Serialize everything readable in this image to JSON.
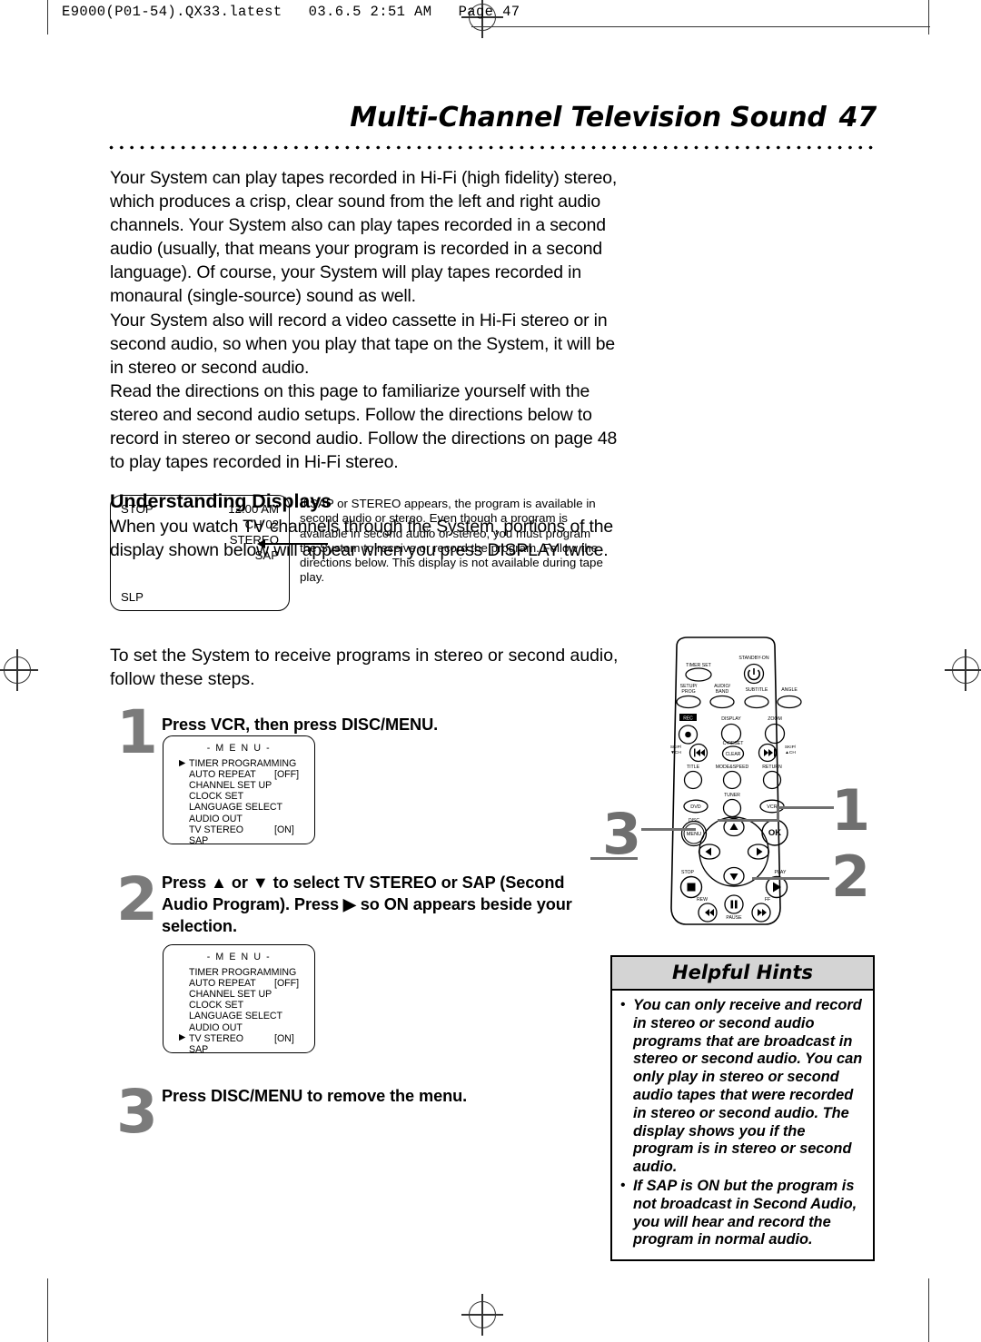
{
  "print_header": {
    "text": "E9000(P01-54).QX33.latest   03.6.5 2:51 AM   Page 47"
  },
  "chapter": {
    "title": "Multi-Channel Television Sound",
    "page_number": "47"
  },
  "body": {
    "paragraphs": [
      "Your System can play tapes recorded in Hi-Fi (high fidelity) stereo, which produces a crisp, clear sound from the left and right audio channels. Your System also can play tapes recorded in a second audio (usually, that means your program is recorded in a second language). Of course, your System will play tapes recorded in monaural (single-source) sound as well.",
      "Your System also will record a video cassette in Hi-Fi stereo or in second audio, so when you play that tape on the System, it will be in stereo or second audio.",
      "Read the directions on this page to familiarize yourself with the stereo and second audio setups.  Follow the directions below to record in stereo or second audio. Follow the directions on page 48 to play tapes recorded in Hi-Fi stereo."
    ],
    "subheading": "Understanding Displays",
    "subheading_paragraph": "When you watch TV channels through the System, portions of the display shown below will appear when you press DISPLAY twice."
  },
  "lcd_display": {
    "stop_label": "STOP",
    "slp_label": "SLP",
    "time": "12:00 AM",
    "channel": "CH 02",
    "stereo": "STEREO",
    "sap": "SAP",
    "note": "If SAP or STEREO appears, the program is available in second audio or stereo. Even though a program is available in second audio or stereo, you must program the System to receive or record the program. Follow the directions below. This display is not available during tape play."
  },
  "steps_intro": "To set the System to receive programs in stereo or second audio, follow these steps.",
  "steps": [
    {
      "number": "1",
      "text": "Press VCR, then press DISC/MENU."
    },
    {
      "number": "2",
      "text": "Press ▲ or ▼ to select TV STEREO or SAP (Second Audio Program). Press ▶ so ON appears beside your selection."
    },
    {
      "number": "3",
      "text": "Press DISC/MENU to remove the menu."
    }
  ],
  "menu_screens": [
    {
      "title": "- M E N U -",
      "cursor_index": 0,
      "items": [
        {
          "label": "TIMER PROGRAMMING",
          "value": ""
        },
        {
          "label": "AUTO REPEAT",
          "value": "[OFF]"
        },
        {
          "label": "CHANNEL SET UP",
          "value": ""
        },
        {
          "label": "CLOCK SET",
          "value": ""
        },
        {
          "label": "LANGUAGE SELECT",
          "value": ""
        },
        {
          "label": "AUDIO OUT",
          "value": ""
        },
        {
          "label": "TV STEREO",
          "value": "[ON]"
        },
        {
          "label": "SAP",
          "value": ""
        }
      ]
    },
    {
      "title": "- M E N U -",
      "cursor_index": 6,
      "items": [
        {
          "label": "TIMER PROGRAMMING",
          "value": ""
        },
        {
          "label": "AUTO REPEAT",
          "value": "[OFF]"
        },
        {
          "label": "CHANNEL SET UP",
          "value": ""
        },
        {
          "label": "CLOCK SET",
          "value": ""
        },
        {
          "label": "LANGUAGE SELECT",
          "value": ""
        },
        {
          "label": "AUDIO OUT",
          "value": ""
        },
        {
          "label": "TV STEREO",
          "value": "[ON]"
        },
        {
          "label": "SAP",
          "value": ""
        }
      ]
    }
  ],
  "helpful_hints": {
    "title": "Helpful Hints",
    "items": [
      "You can only receive and record in stereo or second audio programs that are broadcast in stereo or second audio. You can only play in stereo or second audio tapes that were recorded in stereo or second audio. The display shows you if the program is in stereo or second audio.",
      "If SAP is ON but the program is not broadcast in Second Audio, you will hear and record the program in normal audio."
    ]
  },
  "remote": {
    "callouts": [
      {
        "number": "1",
        "target": "VCR and DISC MENU buttons"
      },
      {
        "number": "2",
        "target": "navigation arrow pad"
      },
      {
        "number": "3",
        "target": "DISC MENU button"
      }
    ],
    "buttons": {
      "timer_set": "TIMER SET",
      "standby_on": "STANDBY-ON",
      "setup_prog": "SETUP/\nPROG",
      "audio_band": "AUDIO/\nBAND",
      "subtitle": "SUBTITLE",
      "angle": "ANGLE",
      "rec": "REC",
      "display": "DISPLAY",
      "zoom": "ZOOM",
      "skip_down": "SKIP/\n▼CH",
      "skip_up": "SKIP/\n▲CH",
      "c_reset": "C-RESET",
      "clear": "CLEAR",
      "title": "TITLE",
      "mode_speed": "MODE&SPEED",
      "return": "RETURN",
      "tuner": "TUNER",
      "dvd": "DVD",
      "vcr": "VCR",
      "disc": "DISC",
      "menu": "MENU",
      "ok": "OK",
      "stop": "STOP",
      "play": "PLAY",
      "rew": "REW",
      "pause": "PAUSE",
      "ff": "FF"
    }
  },
  "colors": {
    "step_number": "#7b7b7b",
    "callout": "#6f6f6f",
    "hints_header_bg": "#d4d4d4"
  }
}
